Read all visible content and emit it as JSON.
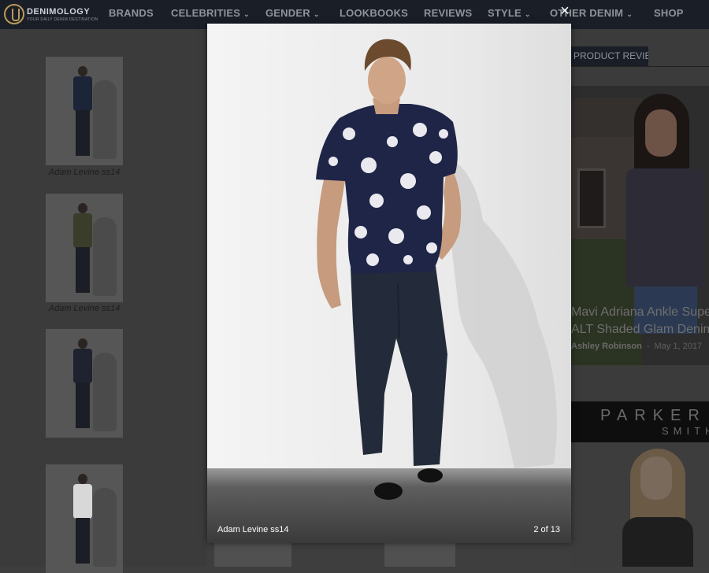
{
  "site": {
    "logo_name": "DENIMOLOGY",
    "logo_tagline": "YOUR DAILY DENIM DESTINATION"
  },
  "nav": {
    "items": [
      {
        "label": "BRANDS",
        "dropdown": false
      },
      {
        "label": "CELEBRITIES",
        "dropdown": true
      },
      {
        "label": "GENDER",
        "dropdown": true
      },
      {
        "label": "LOOKBOOKS",
        "dropdown": false
      },
      {
        "label": "REVIEWS",
        "dropdown": false
      },
      {
        "label": "STYLE",
        "dropdown": true
      },
      {
        "label": "OTHER DENIM",
        "dropdown": true
      },
      {
        "label": "SHOP",
        "dropdown": false
      }
    ]
  },
  "gallery": {
    "thumbnails": [
      {
        "caption": "Adam Levine ss14",
        "shirt_color": "#1c2438"
      },
      {
        "caption": "Adam Levine ss14",
        "shirt_color": "#3a3d2a"
      },
      {
        "caption": "",
        "shirt_color": "#1f2330"
      },
      {
        "caption": "",
        "shirt_color": "#d8d8d8"
      }
    ]
  },
  "sidebar": {
    "section_label": "PRODUCT REVIEWS",
    "review": {
      "title_line1": "Mavi Adriana Ankle Super",
      "title_line2": "ALT Shaded Glam Denim",
      "author": "Ashley Robinson",
      "date": "May 1, 2017"
    },
    "ad": {
      "line1": "PARKER",
      "line2": "SMITH"
    }
  },
  "lightbox": {
    "caption": "Adam Levine ss14",
    "counter": "2 of 13",
    "close_symbol": "×"
  },
  "colors": {
    "nav_bg": "#1a1e27",
    "overlay_bg": "#3e3e3e",
    "shirt_navy": "#1f2547",
    "jeans": "#232b3a"
  }
}
